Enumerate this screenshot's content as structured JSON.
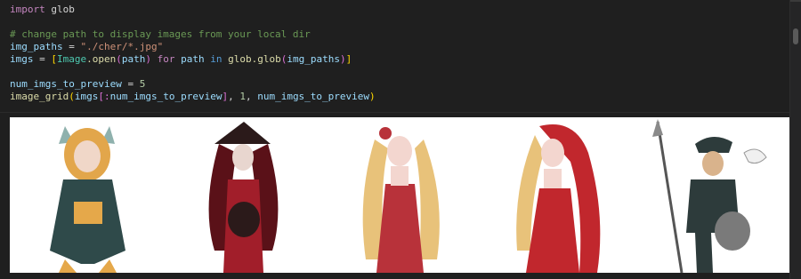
{
  "code_lines": [
    {
      "id": "line-import",
      "text": "import glob"
    },
    {
      "id": "line-blank1",
      "text": ""
    },
    {
      "id": "line-comment",
      "text": "# change path to display images from your local dir"
    },
    {
      "id": "line-img-paths",
      "text": "img_paths = \"./cher/*.jpg\""
    },
    {
      "id": "line-imgs",
      "text": "imgs = [Image.open(path) for path in glob.glob(img_paths)]"
    },
    {
      "id": "line-blank2",
      "text": ""
    },
    {
      "id": "line-num",
      "text": "num_imgs_to_preview = 5"
    },
    {
      "id": "line-grid",
      "text": "image_grid(imgs[:num_imgs_to_preview], 1, num_imgs_to_preview)"
    }
  ],
  "tokens": {
    "import_kw": "import",
    "glob_mod": "glob",
    "comment": "# change path to display images from your local dir",
    "img_paths_var": "img_paths",
    "eq": " = ",
    "path_str": "\"./cher/*.jpg\"",
    "imgs_var": "imgs",
    "open_bracket": "[",
    "image_cls": "Image",
    "open_fn": ".open",
    "paren_open": "(",
    "path_var": "path",
    "paren_close": ")",
    "for_kw": " for ",
    "in_kw": " in ",
    "glob_call": "glob.glob",
    "close_bracket": "]",
    "num_var": "num_imgs_to_preview",
    "num_val": "5",
    "grid_fn": "image_grid",
    "slice_open": "[:",
    "one": "1",
    "comma": ", "
  },
  "output": {
    "images": [
      {
        "name": "character-1",
        "palette": [
          "#2f4a4a",
          "#e5a84a",
          "#c4d1cf"
        ]
      },
      {
        "name": "character-2",
        "palette": [
          "#7a1b24",
          "#2b1a1a",
          "#d9c7c0"
        ]
      },
      {
        "name": "character-3",
        "palette": [
          "#b8323a",
          "#e8c27a",
          "#f3d6cf"
        ]
      },
      {
        "name": "character-4",
        "palette": [
          "#c1272d",
          "#e8c27a",
          "#f3d6cf"
        ]
      },
      {
        "name": "character-5",
        "palette": [
          "#2d3b3b",
          "#d9b38c",
          "#8a8a8a"
        ]
      }
    ]
  }
}
